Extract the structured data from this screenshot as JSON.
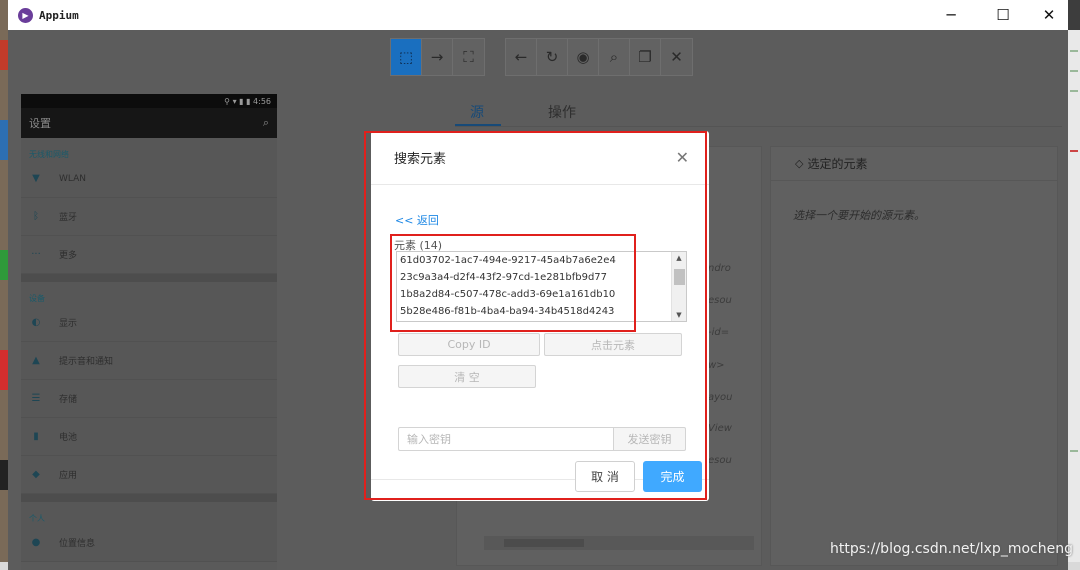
{
  "window": {
    "title": "Appium"
  },
  "toolbar": {
    "select_icon": "select-cursor-icon",
    "swipe_icon": "swipe-arrow-icon",
    "tap_icon": "tap-coordinates-icon",
    "back_icon": "back-arrow-icon",
    "refresh_icon": "refresh-icon",
    "show_icon": "eye-icon",
    "search_icon": "search-icon",
    "copy_icon": "copy-xml-icon",
    "quit_icon": "close-icon",
    "active_color": "#1a6fbf"
  },
  "device": {
    "time": "4:56",
    "app_title": "设置",
    "sections": [
      {
        "heading": "无线和网络",
        "items": [
          "WLAN",
          "蓝牙",
          "更多"
        ]
      },
      {
        "heading": "设备",
        "items": [
          "显示",
          "提示音和通知",
          "存储",
          "电池",
          "应用"
        ]
      },
      {
        "heading": "个人",
        "items": [
          "位置信息"
        ]
      }
    ]
  },
  "tabs": {
    "source": "源",
    "actions": "操作"
  },
  "source_panel": {
    "fragments": [
      "ndro",
      "esou",
      "-id=",
      "w>",
      "ayou",
      "View",
      "esou"
    ]
  },
  "selected_panel": {
    "title": "选定的元素",
    "hint": "选择一个要开始的源元素。"
  },
  "modal": {
    "title": "搜索元素",
    "back": "<< 返回",
    "elements_label": "元素 (14)",
    "elements": [
      "61d03702-1ac7-494e-9217-45a4b7a6e2e4",
      "23c9a3a4-d2f4-43f2-97cd-1e281bfb9d77",
      "1b8a2d84-c507-478c-add3-69e1a161db10",
      "5b28e486-f81b-4ba4-ba94-34b4518d4243"
    ],
    "copy_id": "Copy ID",
    "tap_element": "点击元素",
    "clear": "清 空",
    "key_placeholder": "输入密钥",
    "send_keys": "发送密钥",
    "cancel": "取 消",
    "done": "完成",
    "primary_color": "#40a9ff"
  },
  "watermark": "https://blog.csdn.net/lxp_mocheng"
}
